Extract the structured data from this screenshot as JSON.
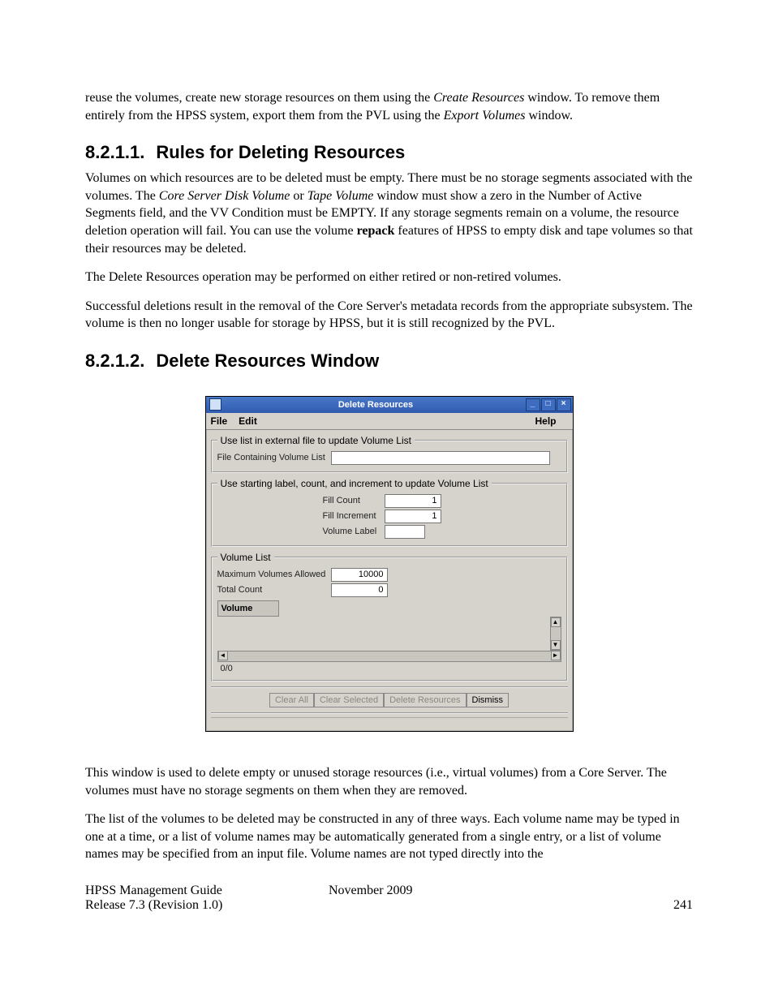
{
  "intro": {
    "p1_a": "reuse the volumes, create new storage resources on them using the ",
    "p1_i1": "Create Resources",
    "p1_b": " window. To remove them entirely from the HPSS system, export them from the PVL using the ",
    "p1_i2": "Export Volumes",
    "p1_c": " window."
  },
  "section1": {
    "num": "8.2.1.1.",
    "title": "Rules for Deleting Resources",
    "p1_a": "Volumes on which resources are to be deleted must be empty. There must be no storage segments associated with the volumes. The ",
    "p1_i1": "Core Server Disk Volume",
    "p1_b": " or ",
    "p1_i2": "Tape Volume",
    "p1_c": " window must show a zero in the Number of Active Segments field, and the VV Condition must be EMPTY. If any storage segments remain on a volume, the resource deletion operation will fail. You can use the volume ",
    "p1_bold": "repack",
    "p1_d": " features of HPSS to empty disk and tape volumes so that their resources may be deleted.",
    "p2": "The Delete Resources operation may be performed on either retired or non-retired volumes.",
    "p3": "Successful deletions result in the removal of the Core Server's metadata records from the appropriate subsystem. The volume is then no longer usable for storage by HPSS, but it is still recognized by the PVL."
  },
  "section2": {
    "num": "8.2.1.2.",
    "title": "Delete Resources Window",
    "p_after1": "This window is used to delete empty or unused storage resources (i.e., virtual volumes) from a Core Server. The volumes must have no storage segments on them when they are removed.",
    "p_after2": "The list of the volumes to be deleted may be constructed in any of three ways. Each volume name may be typed in one at a time, or a list of volume names may be automatically generated from a single entry, or a list of volume names may be specified from an input file. Volume names are not typed directly into the"
  },
  "gui": {
    "title": "Delete Resources",
    "menu": {
      "file": "File",
      "edit": "Edit",
      "help": "Help"
    },
    "titlebar": {
      "min": "_",
      "max": "□",
      "close": "×"
    },
    "fs1": {
      "legend": "Use list in external file to update Volume List",
      "file_label": "File Containing Volume List",
      "file_value": ""
    },
    "fs2": {
      "legend": "Use starting label, count, and increment to update Volume List",
      "fill_count_label": "Fill Count",
      "fill_count_value": "1",
      "fill_increment_label": "Fill Increment",
      "fill_increment_value": "1",
      "volume_label_label": "Volume Label",
      "volume_label_value": ""
    },
    "fs3": {
      "legend": "Volume List",
      "max_label": "Maximum Volumes Allowed",
      "max_value": "10000",
      "total_label": "Total Count",
      "total_value": "0",
      "col_header": "Volume",
      "status": "0/0"
    },
    "buttons": {
      "clear_all": "Clear All",
      "clear_selected": "Clear Selected",
      "delete_resources": "Delete Resources",
      "dismiss": "Dismiss"
    }
  },
  "footer": {
    "guide": "HPSS Management Guide",
    "release": "Release 7.3 (Revision 1.0)",
    "date": "November 2009",
    "page": "241"
  }
}
